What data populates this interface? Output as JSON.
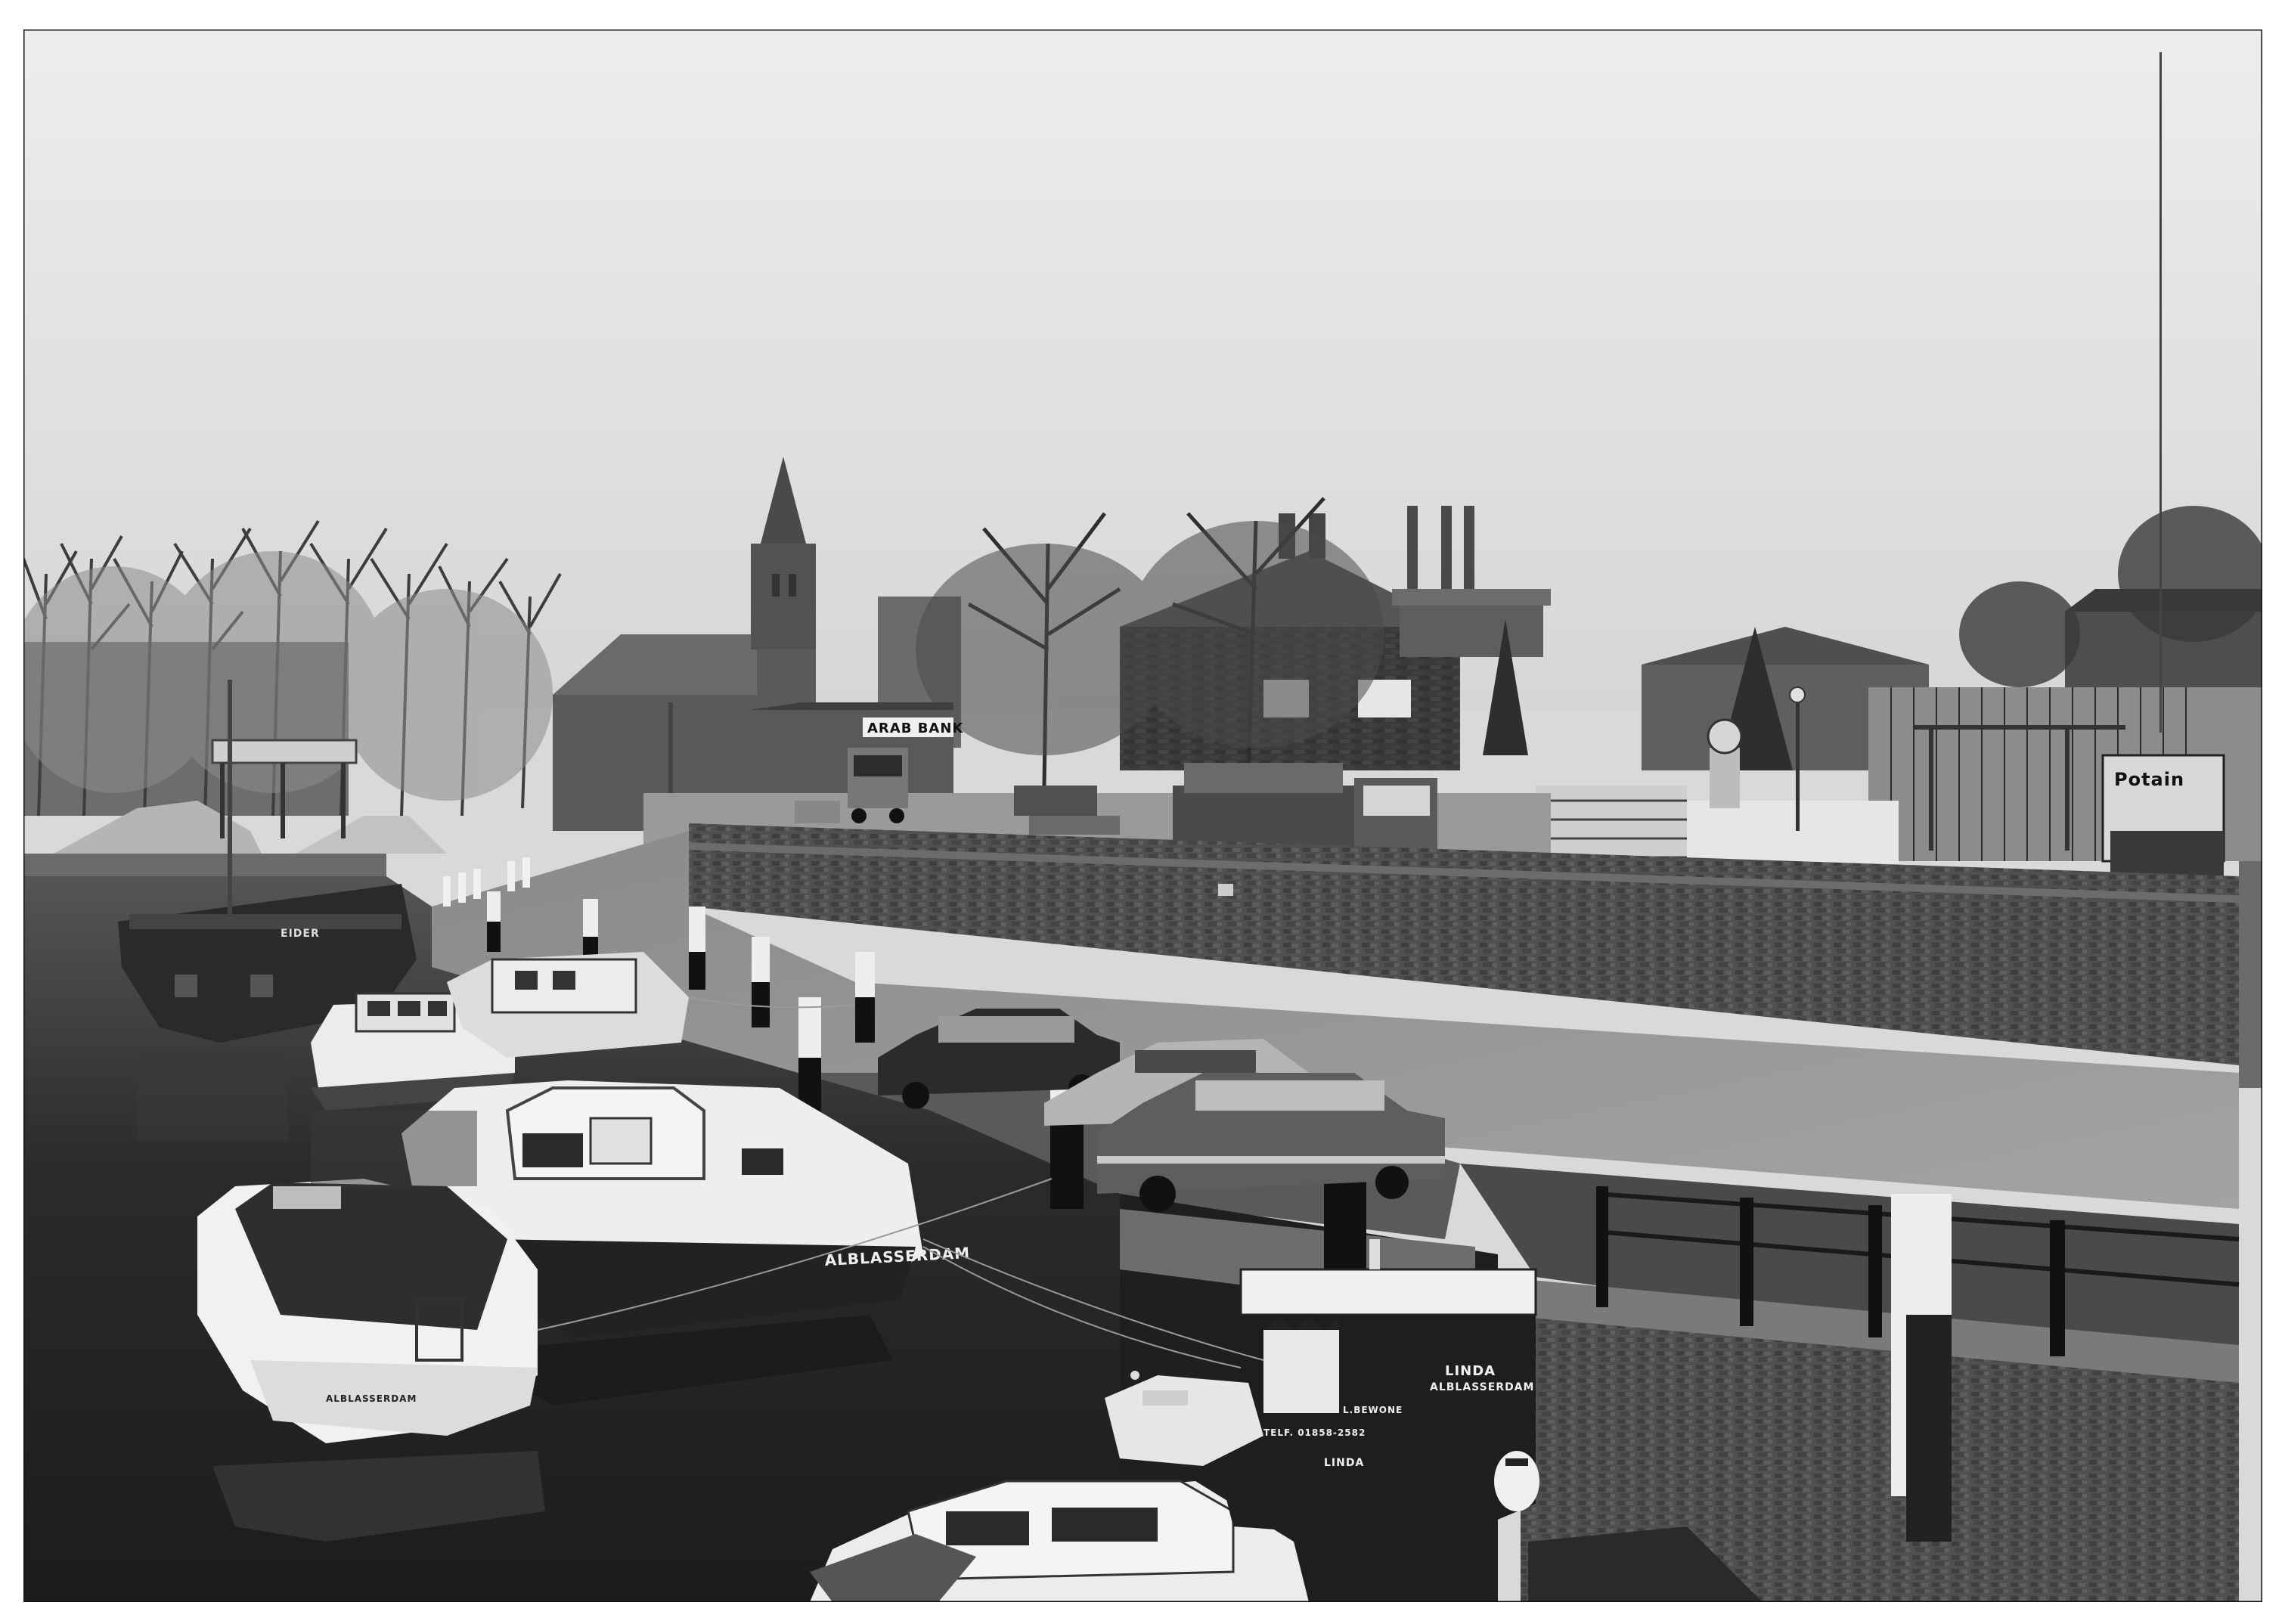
{
  "photo": {
    "signs": {
      "shop_sign": "ARAB BANK",
      "crane_brand": "Potain",
      "boat_name_large": "ALBLASSERDAM",
      "boat_name_stern": "ALBLASSERDAM",
      "barge_name": "EIDER",
      "tug_name_top": "LINDA",
      "tug_port_top": "ALBLASSERDAM",
      "tug_phone": "TELF. 01858-2582",
      "tug_name_side": "LINDA",
      "tug_owner_side": "L.BEWONE"
    }
  },
  "palette": {
    "sky": "#e4e4e4",
    "water": "#2f2f2f",
    "wall": "#4a4a4a",
    "quay": "#7a7a7a",
    "white_hull": "#efefef",
    "dark": "#151515"
  }
}
